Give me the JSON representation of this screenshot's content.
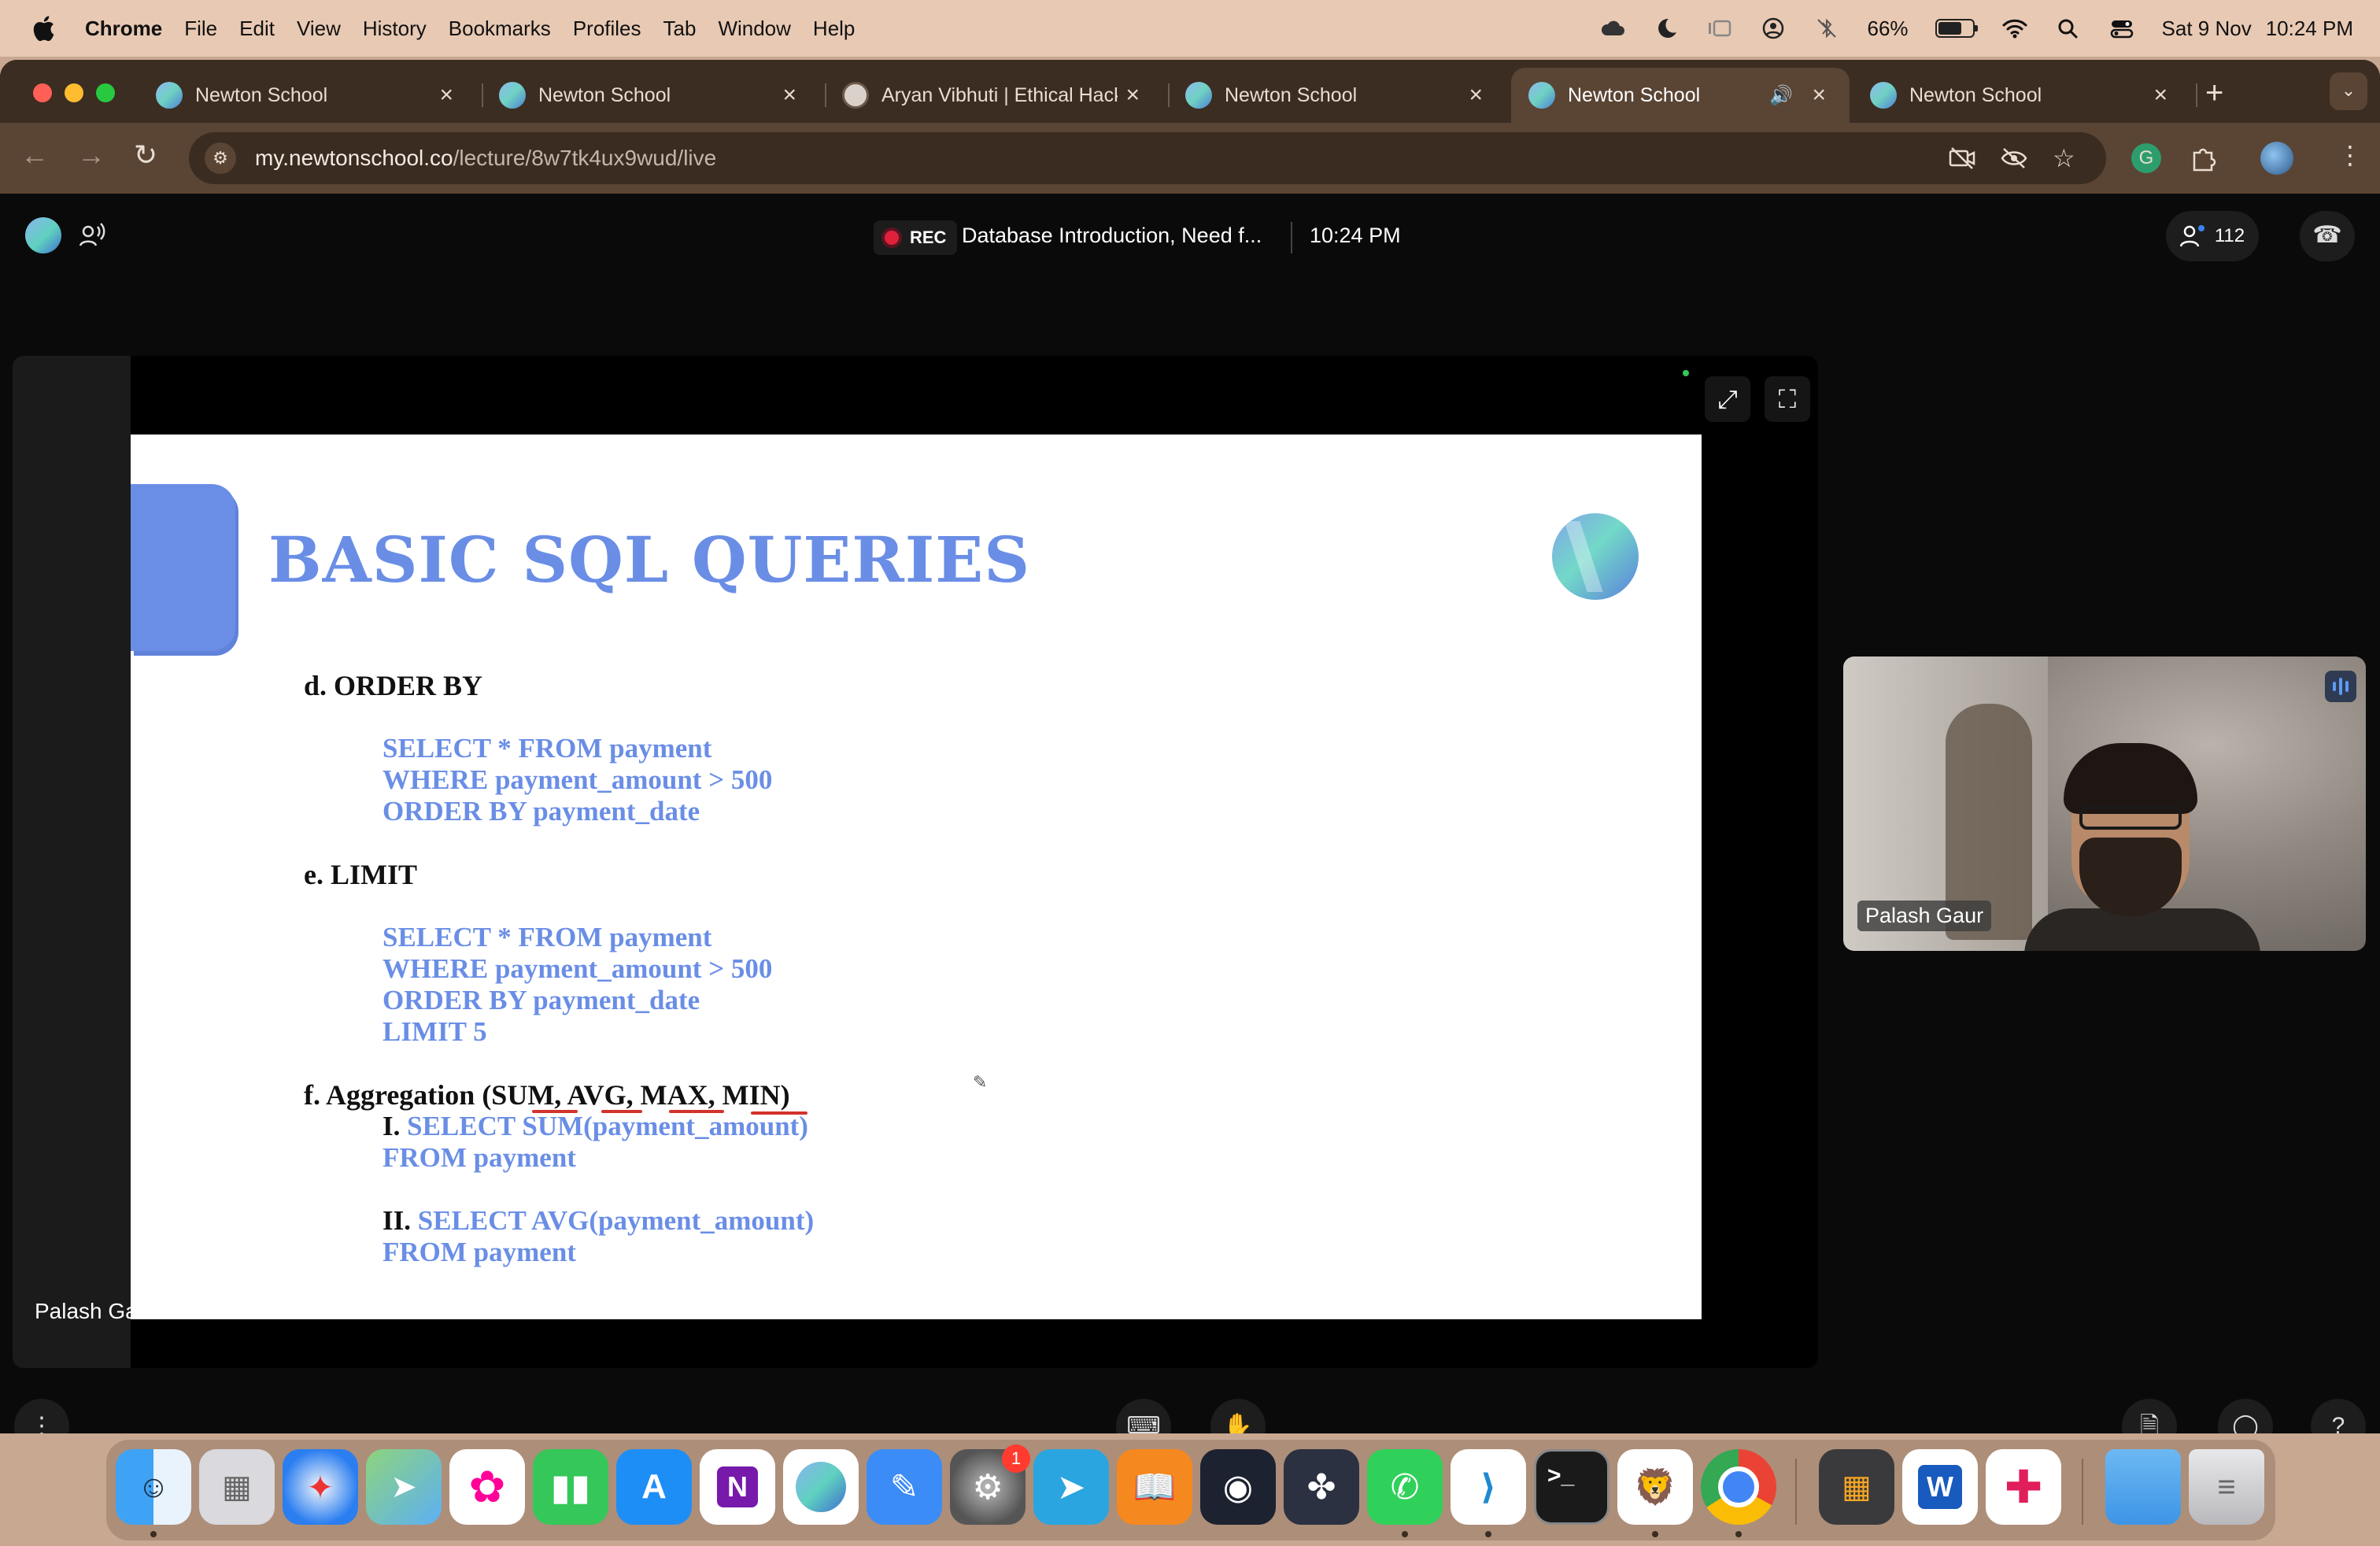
{
  "menubar": {
    "app_name": "Chrome",
    "menus": [
      "File",
      "Edit",
      "View",
      "History",
      "Bookmarks",
      "Profiles",
      "Tab",
      "Window",
      "Help"
    ],
    "battery": "66%",
    "date": "Sat 9 Nov",
    "time": "10:24 PM"
  },
  "tabs": [
    {
      "title": "Newton School",
      "active": false
    },
    {
      "title": "Newton School",
      "active": false
    },
    {
      "title": "Aryan Vibhuti | Ethical Hacker",
      "active": false
    },
    {
      "title": "Newton School",
      "active": false
    },
    {
      "title": "Newton School",
      "active": true
    },
    {
      "title": "Newton School",
      "active": false
    }
  ],
  "address_bar": {
    "host": "my.newtonschool.co",
    "path": "/lecture/8w7tk4ux9wud/live"
  },
  "meeting": {
    "rec_label": "REC",
    "title": "Database Introduction, Need f...",
    "time": "10:24 PM",
    "participant_count": "112",
    "presenter_label": "Palash Gaur"
  },
  "slide": {
    "title": "BASIC SQL QUERIES",
    "d_heading": "d. ORDER BY",
    "d_code": [
      "SELECT * FROM payment",
      "WHERE payment_amount > 500",
      "ORDER BY payment_date"
    ],
    "e_heading": "e. LIMIT",
    "e_code": [
      "SELECT * FROM payment",
      "WHERE payment_amount > 500",
      "ORDER BY payment_date",
      "LIMIT 5"
    ],
    "f_heading": "f. Aggregation (SUM, AVG, MAX, MIN)",
    "f1_num": "I.",
    "f1_code": [
      "SELECT SUM(payment_amount)",
      "FROM payment"
    ],
    "f2_num": "II.",
    "f2_code": [
      "SELECT AVG(payment_amount)",
      "FROM payment"
    ]
  },
  "participant_tile": {
    "name": "Palash Gaur"
  },
  "dock": {
    "badge_count": "1",
    "apps": [
      "finder-icon",
      "launchpad-icon",
      "safari-icon",
      "maps-icon",
      "photos-icon",
      "numbers-icon",
      "app-store-icon",
      "onenote-icon",
      "newton-school-icon",
      "pages-icon",
      "system-settings-icon",
      "telegram-icon",
      "books-icon",
      "obs-icon",
      "davinci-resolve-icon",
      "whatsapp-icon",
      "vscode-icon",
      "terminal-icon",
      "brave-icon",
      "chrome-icon",
      "calculator-icon",
      "word-icon",
      "slack-icon",
      "folder-icon",
      "trash-icon"
    ]
  },
  "colors": {
    "slide_blue": "#6a8ee6",
    "rec_red": "#e0213c",
    "underline_red": "#d2332b"
  }
}
